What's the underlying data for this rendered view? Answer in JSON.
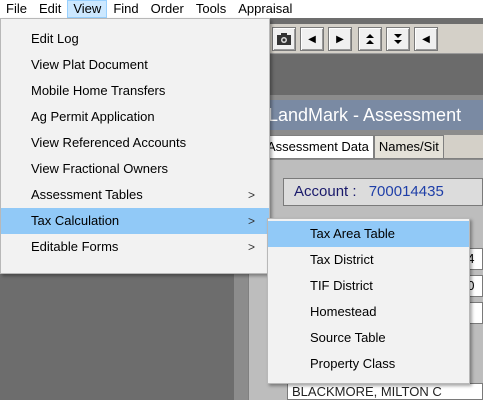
{
  "menubar": {
    "items": [
      "File",
      "Edit",
      "View",
      "Find",
      "Order",
      "Tools",
      "Appraisal"
    ],
    "active": "View"
  },
  "view_menu": {
    "items": [
      {
        "label": "Edit Log",
        "submenu": false
      },
      {
        "label": "View Plat Document",
        "submenu": false
      },
      {
        "label": "Mobile Home Transfers",
        "submenu": false
      },
      {
        "label": "Ag Permit Application",
        "submenu": false
      },
      {
        "label": "View Referenced Accounts",
        "submenu": false
      },
      {
        "label": "View Fractional Owners",
        "submenu": false
      },
      {
        "label": "Assessment Tables",
        "submenu": true
      },
      {
        "label": "Tax Calculation",
        "submenu": true
      },
      {
        "label": "Editable Forms",
        "submenu": true
      }
    ],
    "highlighted": "Tax Calculation"
  },
  "tax_menu": {
    "items": [
      "Tax Area Table",
      "Tax District",
      "TIF District",
      "Homestead",
      "Source Table",
      "Property Class"
    ],
    "highlighted": "Tax Area Table"
  },
  "toolbar": {
    "icons": [
      "camera-icon",
      "arrow-left-icon",
      "arrow-right-icon",
      "arrow-up-icon",
      "arrow-down-icon"
    ]
  },
  "app": {
    "title": "LandMark - Assessment",
    "tabs": [
      "Assessment Data",
      "Names/Sit"
    ],
    "account_label": "Account :",
    "account_value": "700014435",
    "field_1": "34",
    "field_2": "00",
    "owner": "BLACKMORE, MILTON C"
  },
  "colors": {
    "menu_highlight": "#91c9f7",
    "menubar_active": "#cce8ff",
    "account_value": "#1f3fa8"
  }
}
